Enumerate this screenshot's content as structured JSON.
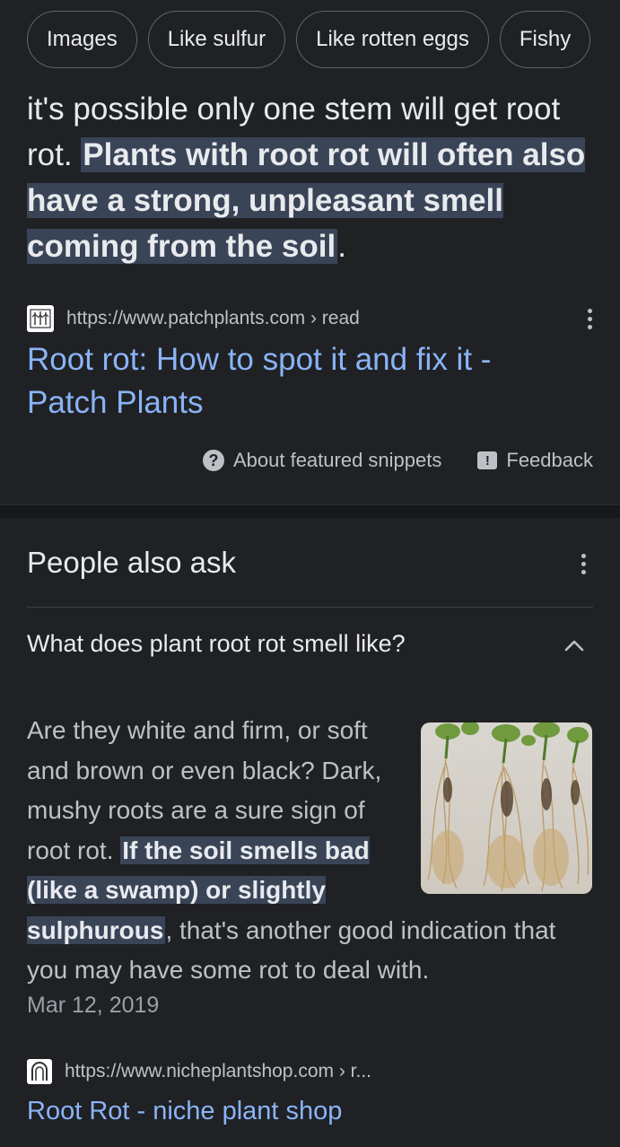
{
  "chips": [
    "Images",
    "Like sulfur",
    "Like rotten eggs",
    "Fishy"
  ],
  "snippet": {
    "text_plain": "it's possible only one stem will get root rot. ",
    "text_highlight": "Plants with root rot will often also have a strong, unpleasant smell coming from the soil",
    "text_end": "."
  },
  "result1": {
    "url": "https://www.patchplants.com › read",
    "title": "Root rot: How to spot it and fix it - Patch Plants",
    "favicon": "patch-plants-favicon"
  },
  "footer": {
    "about": "About featured snippets",
    "feedback": "Feedback"
  },
  "paa": {
    "title": "People also ask",
    "question": "What does plant root rot smell like?",
    "answer_plain": "Are they white and firm, or soft and brown or even black? Dark, mushy roots are a sure sign of root rot. ",
    "answer_highlight": "If the soil smells bad (like a swamp) or slightly sulphurous",
    "answer_end": ", that's another good indication that you may have some rot to deal with.",
    "date": "Mar 12, 2019"
  },
  "result2": {
    "url": "https://www.nicheplantshop.com › r...",
    "title": "Root Rot - niche plant shop",
    "favicon": "niche-plant-shop-favicon"
  },
  "colors": {
    "background": "#202124",
    "link": "#8ab4f8",
    "highlight": "#394457",
    "text": "#e8eaed",
    "secondary_text": "#bdc1c6"
  }
}
